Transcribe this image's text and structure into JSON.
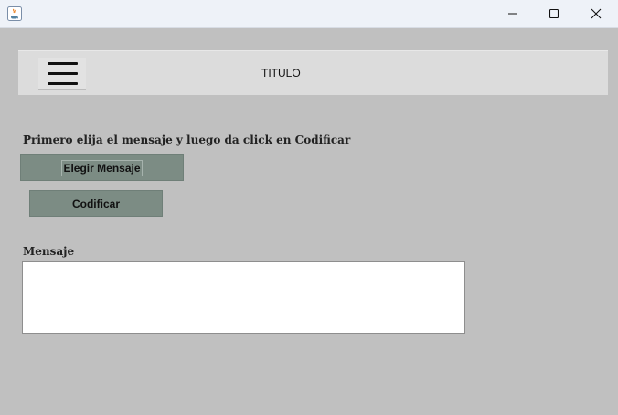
{
  "window": {
    "icon": "java-icon",
    "controls": {
      "minimize_icon": "minimize-icon",
      "maximize_icon": "maximize-icon",
      "close_icon": "close-icon"
    }
  },
  "header": {
    "menu_icon": "hamburger-menu-icon",
    "title": "TITULO"
  },
  "main": {
    "instruction": "Primero elija el mensaje y luego da click en Codificar",
    "choose_button_label": "Elegir Mensaje",
    "encode_button_label": "Codificar",
    "message_label": "Mensaje",
    "message_value": ""
  },
  "colors": {
    "background": "#c0c0c0",
    "header_bg": "#dcdcdc",
    "button_bg": "#7c8c84",
    "textarea_bg": "#ffffff"
  }
}
